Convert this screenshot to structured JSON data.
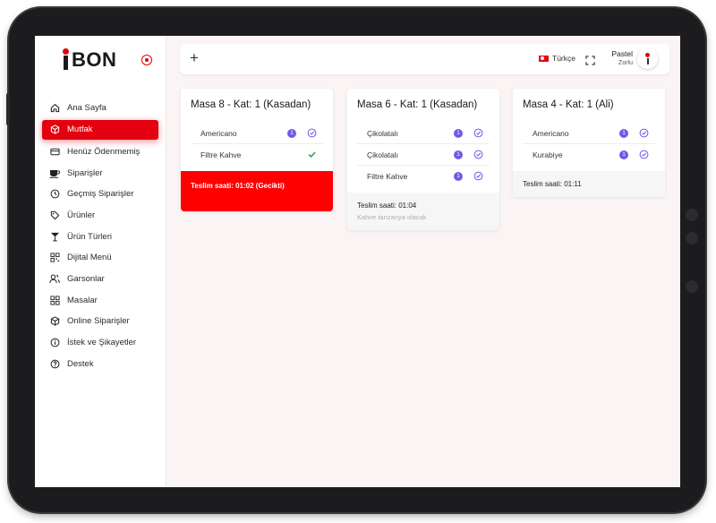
{
  "brand": {
    "logo_text": "BON",
    "accent": "#e3000f"
  },
  "sidebar": {
    "items": [
      {
        "label": "Ana Sayfa",
        "icon": "home-icon"
      },
      {
        "label": "Mutfak",
        "icon": "cube-icon",
        "active": true
      },
      {
        "label": "Henüz Ödenmemiş",
        "icon": "card-icon"
      },
      {
        "label": "Siparişler",
        "icon": "cup-icon"
      },
      {
        "label": "Geçmiş Siparişler",
        "icon": "clock-icon"
      },
      {
        "label": "Ürünler",
        "icon": "tag-icon"
      },
      {
        "label": "Ürün Türleri",
        "icon": "glass-icon"
      },
      {
        "label": "Dijital Menü",
        "icon": "qr-icon"
      },
      {
        "label": "Garsonlar",
        "icon": "users-icon"
      },
      {
        "label": "Masalar",
        "icon": "grid-icon"
      },
      {
        "label": "Online Siparişler",
        "icon": "box-icon"
      },
      {
        "label": "İstek ve Şikayetler",
        "icon": "info-icon"
      },
      {
        "label": "Destek",
        "icon": "help-icon"
      }
    ]
  },
  "topbar": {
    "add_label": "+",
    "language": "Türkçe",
    "user_name": "Pastel",
    "user_sub": "Zorlu"
  },
  "orders": [
    {
      "title": "Masa 8 - Kat: 1 (Kasadan)",
      "items": [
        {
          "name": "Americano",
          "qty": "1",
          "status": "pending"
        },
        {
          "name": "Filtre Kahve",
          "qty": "",
          "status": "done"
        }
      ],
      "footer": "Teslim saati: 01:02 (Gecikti)",
      "note": "",
      "late": true
    },
    {
      "title": "Masa 6 - Kat: 1 (Kasadan)",
      "items": [
        {
          "name": "Çikolatalı",
          "qty": "1",
          "status": "pending"
        },
        {
          "name": "Çikolatalı",
          "qty": "1",
          "status": "pending"
        },
        {
          "name": "Filtre Kahve",
          "qty": "1",
          "status": "pending"
        }
      ],
      "footer": "Teslim saati: 01:04",
      "note": "Kahve tanzanya olacak",
      "late": false
    },
    {
      "title": "Masa 4 - Kat: 1 (Ali)",
      "items": [
        {
          "name": "Americano",
          "qty": "1",
          "status": "pending"
        },
        {
          "name": "Kurabiye",
          "qty": "1",
          "status": "pending"
        }
      ],
      "footer": "Teslim saati: 01:11",
      "note": "",
      "late": false
    }
  ]
}
